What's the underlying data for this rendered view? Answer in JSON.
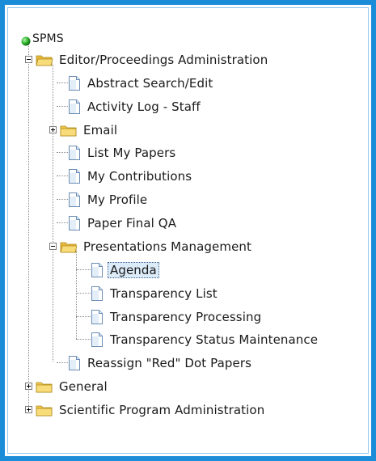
{
  "root": {
    "label": "SPMS",
    "status_color": "#22aa22"
  },
  "tree": [
    {
      "label": "Editor/Proceedings Administration",
      "type": "folder",
      "state": "expanded"
    },
    {
      "label": "Abstract Search/Edit",
      "type": "page"
    },
    {
      "label": "Activity Log - Staff",
      "type": "page"
    },
    {
      "label": "Email",
      "type": "folder",
      "state": "collapsed"
    },
    {
      "label": "List My Papers",
      "type": "page"
    },
    {
      "label": "My Contributions",
      "type": "page"
    },
    {
      "label": "My Profile",
      "type": "page"
    },
    {
      "label": "Paper Final QA",
      "type": "page"
    },
    {
      "label": "Presentations Management",
      "type": "folder",
      "state": "expanded"
    },
    {
      "label": "Agenda",
      "type": "page",
      "selected": true
    },
    {
      "label": "Transparency List",
      "type": "page"
    },
    {
      "label": "Transparency Processing",
      "type": "page"
    },
    {
      "label": "Transparency Status Maintenance",
      "type": "page"
    },
    {
      "label": "Reassign \"Red\" Dot Papers",
      "type": "page"
    },
    {
      "label": "General",
      "type": "folder",
      "state": "collapsed"
    },
    {
      "label": "Scientific Program Administration",
      "type": "folder",
      "state": "collapsed"
    }
  ],
  "colors": {
    "frame": "#1a8cd8",
    "folder": "#f2c94c",
    "selection": "#dcebf8"
  },
  "icons": {
    "folder": "folder-icon",
    "page": "page-icon",
    "root": "status-dot-icon"
  }
}
